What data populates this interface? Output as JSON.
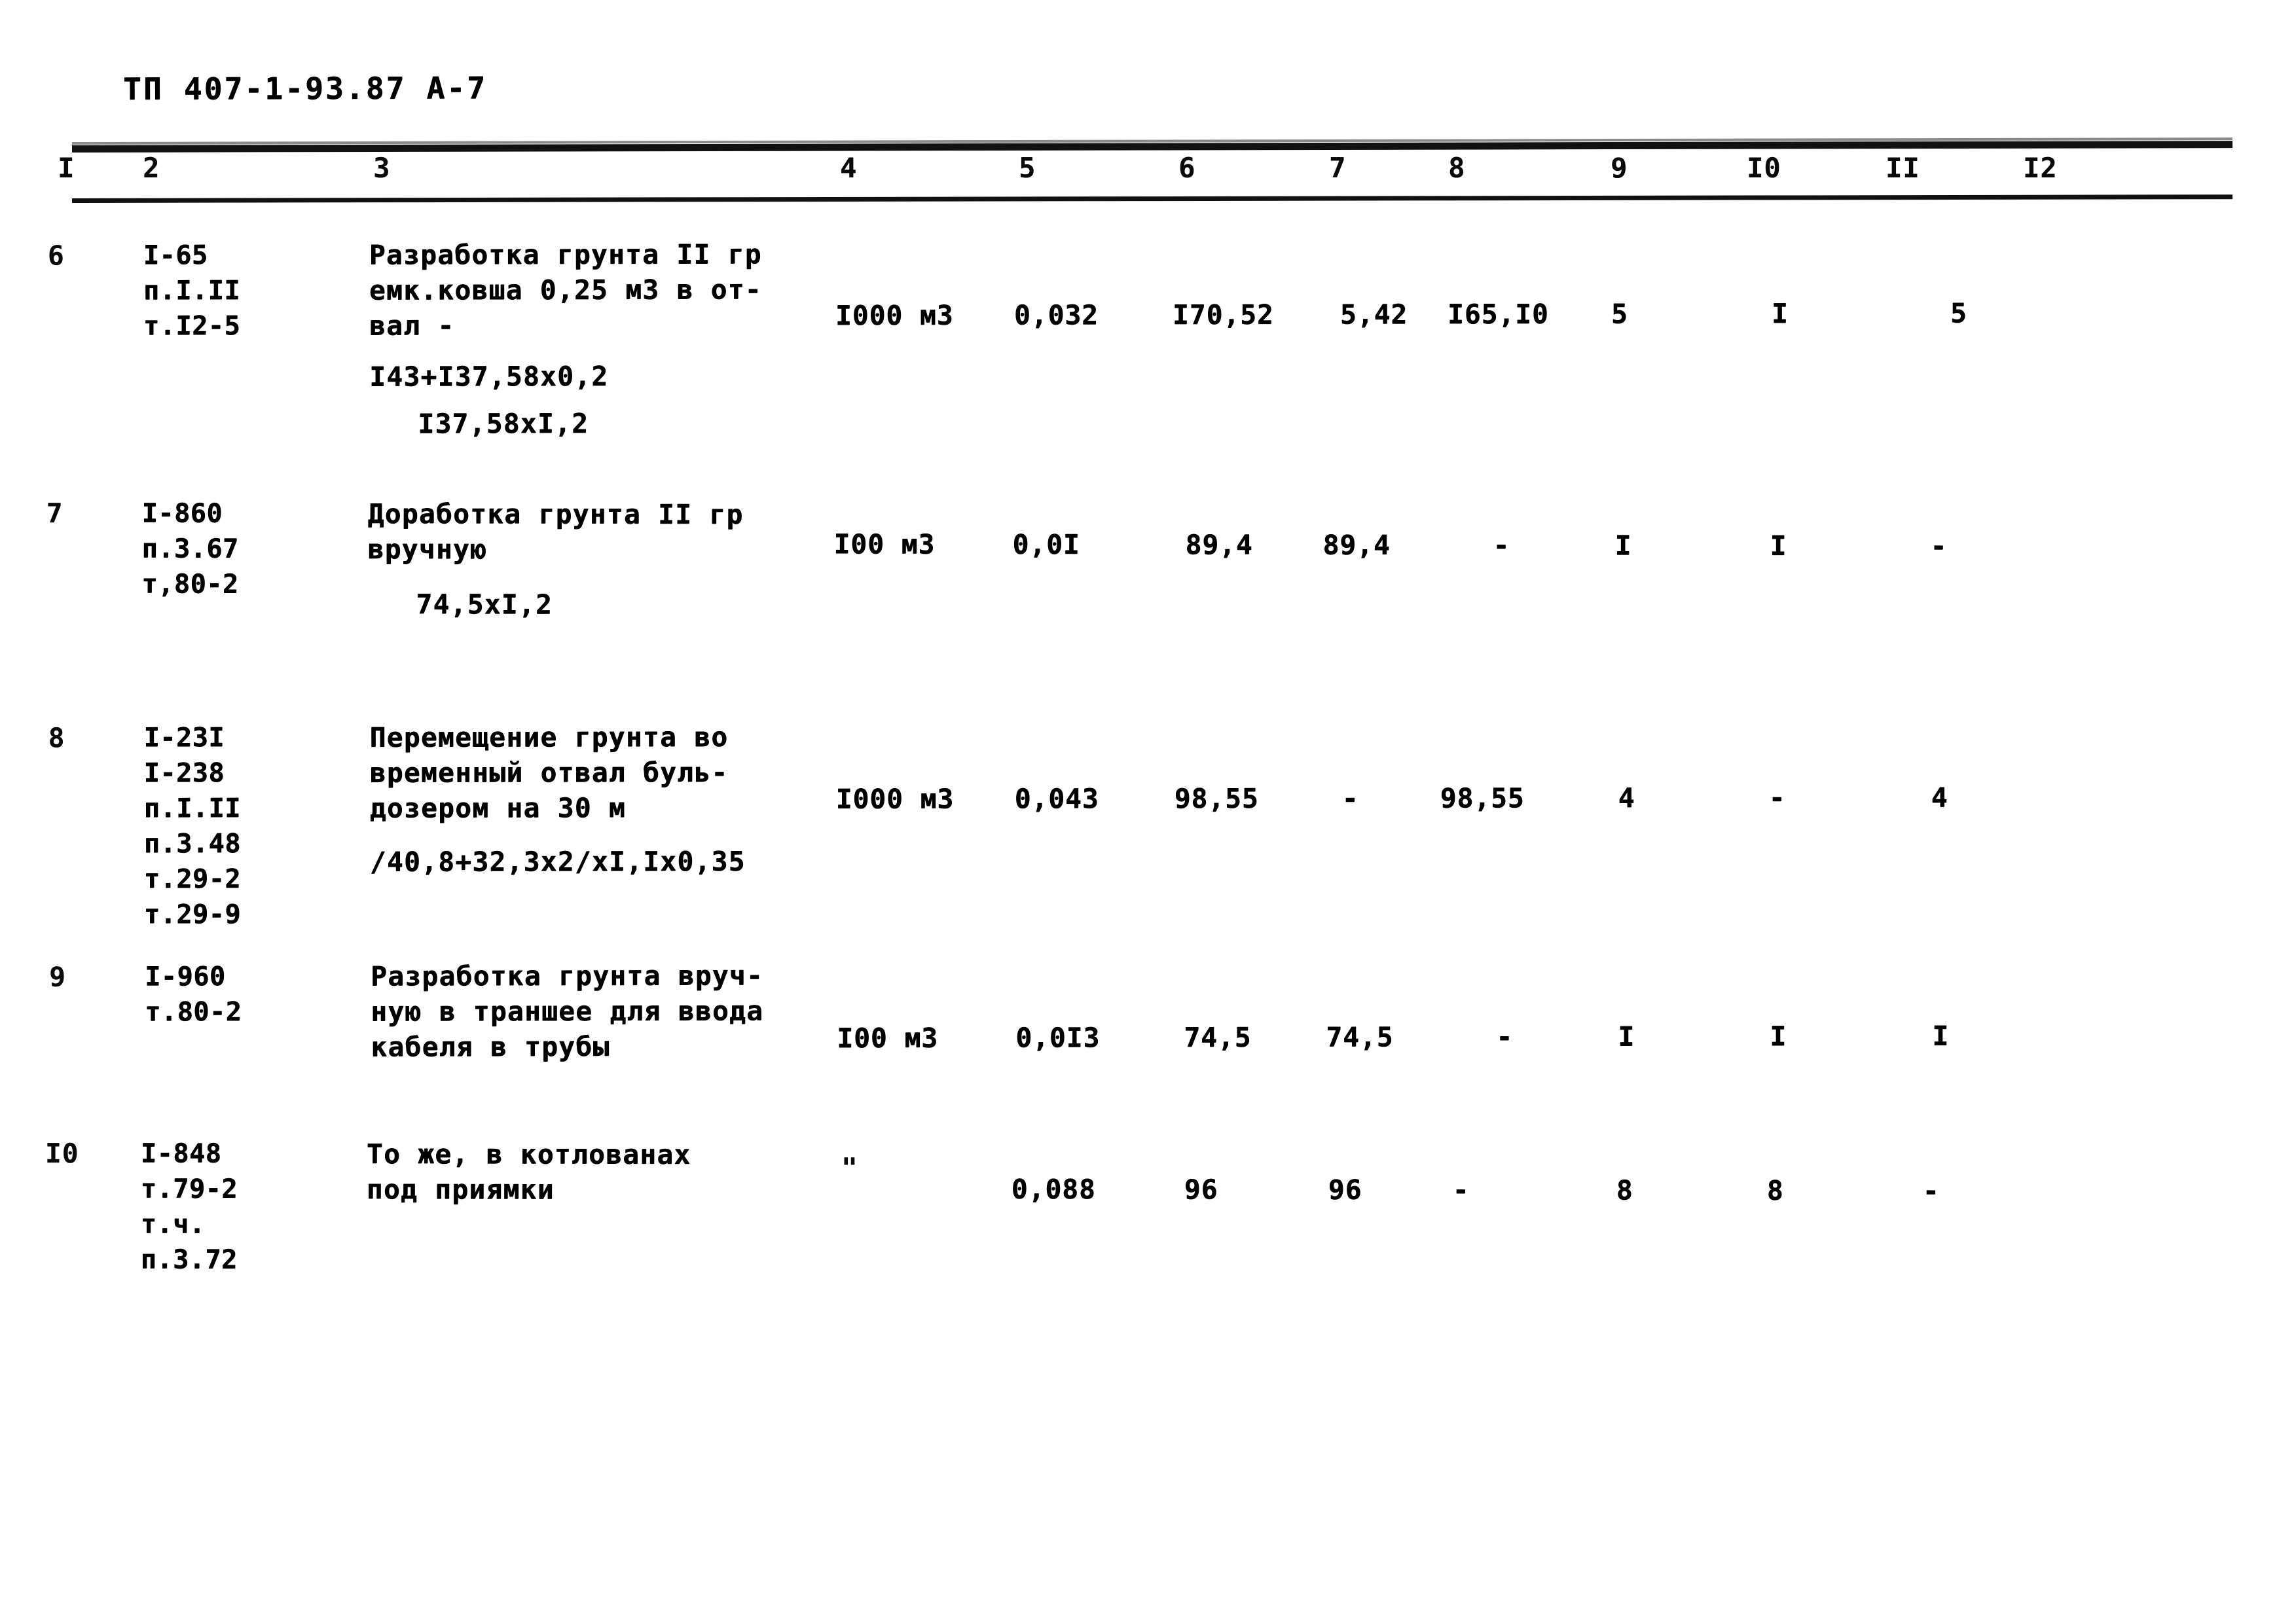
{
  "document": {
    "title": "ТП 407-1-93.87 А-7"
  },
  "table": {
    "column_headers": [
      "I",
      "2",
      "3",
      "4",
      "5",
      "6",
      "7",
      "8",
      "9",
      "I0",
      "II",
      "I2"
    ],
    "rows": [
      {
        "no": "6",
        "code": "I-65\nп.I.II\nт.I2-5",
        "description": "Разработка грунта II гр\nемк.ковша 0,25 м3 в от-\nвал -",
        "formulas": [
          "I43+I37,58х0,2",
          "I37,58хI,2"
        ],
        "unit": "I000 м3",
        "c5": "0,032",
        "c6": "I70,52",
        "c7": "5,42",
        "c8": "I65,I0",
        "c9": "5",
        "c10": "I",
        "c11": "5",
        "c12": ""
      },
      {
        "no": "7",
        "code": "I-860\nп.3.67\nт,80-2",
        "description": "Доработка грунта II гр\nвручную",
        "formulas": [
          "74,5хI,2"
        ],
        "unit": "I00 м3",
        "c5": "0,0I",
        "c6": "89,4",
        "c7": "89,4",
        "c8": "-",
        "c9": "I",
        "c10": "I",
        "c11": "-",
        "c12": ""
      },
      {
        "no": "8",
        "code": "I-23I\nI-238\nп.I.II\nп.3.48\nт.29-2\nт.29-9",
        "description": "Перемещение грунта во\nвременный отвал буль-\nдозером на 30 м",
        "formulas": [
          "/40,8+32,3х2/хI,Iх0,35"
        ],
        "unit": "I000 м3",
        "c5": "0,043",
        "c6": "98,55",
        "c7": "-",
        "c8": "98,55",
        "c9": "4",
        "c10": "-",
        "c11": "4",
        "c12": ""
      },
      {
        "no": "9",
        "code": "I-960\nт.80-2",
        "description": "Разработка грунта вруч-\nную в траншее для ввода\nкабеля в трубы",
        "formulas": [],
        "unit": "I00 м3",
        "c5": "0,0I3",
        "c6": "74,5",
        "c7": "74,5",
        "c8": "-",
        "c9": "I",
        "c10": "I",
        "c11": "I",
        "c12": ""
      },
      {
        "no": "I0",
        "code": "I-848\nт.79-2\nт.ч.\nп.3.72",
        "description": "То же, в котлованах\nпод приямки",
        "formulas": [],
        "unit": "\"",
        "c5": "0,088",
        "c6": "96",
        "c7": "96",
        "c8": "-",
        "c9": "8",
        "c10": "8",
        "c11": "-",
        "c12": ""
      }
    ]
  }
}
